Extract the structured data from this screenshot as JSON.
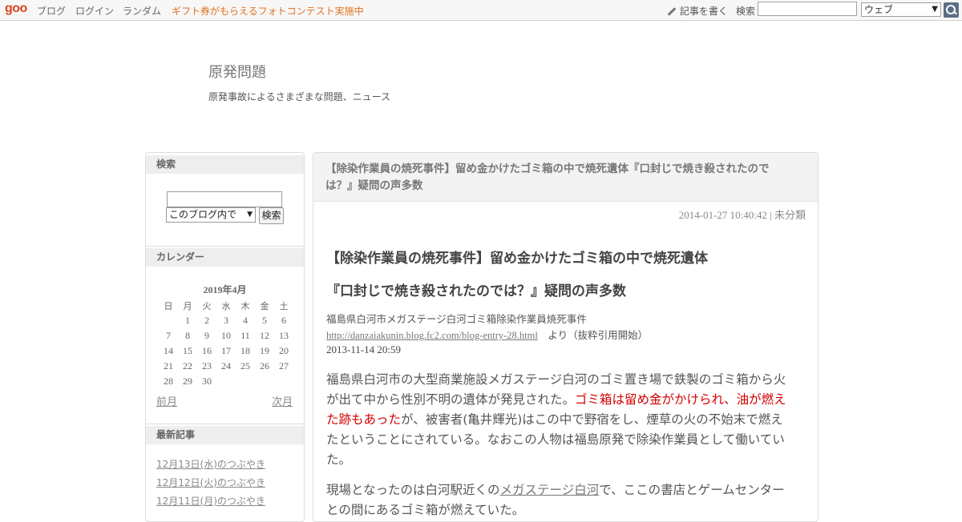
{
  "topbar": {
    "logo": "goo",
    "nav": [
      "ブログ",
      "ログイン",
      "ランダム"
    ],
    "promo": "ギフト券がもらえるフォトコンテスト実施中",
    "write_label": "記事を書く",
    "search_label": "検索",
    "search_value": "",
    "search_scope": "ウェブ"
  },
  "header": {
    "title": "原発問題",
    "description": "原発事故によるさまざまな問題、ニュース"
  },
  "sidebar": {
    "search": {
      "heading": "検索",
      "input_value": "",
      "scope": "このブログ内で",
      "button": "検索"
    },
    "calendar": {
      "heading": "カレンダー",
      "title": "2019年4月",
      "weekdays": [
        "日",
        "月",
        "火",
        "水",
        "木",
        "金",
        "土"
      ],
      "weeks": [
        [
          "",
          "1",
          "2",
          "3",
          "4",
          "5",
          "6"
        ],
        [
          "7",
          "8",
          "9",
          "10",
          "11",
          "12",
          "13"
        ],
        [
          "14",
          "15",
          "16",
          "17",
          "18",
          "19",
          "20"
        ],
        [
          "21",
          "22",
          "23",
          "24",
          "25",
          "26",
          "27"
        ],
        [
          "28",
          "29",
          "30",
          "",
          "",
          "",
          ""
        ]
      ],
      "prev": "前月",
      "next": "次月"
    },
    "recent": {
      "heading": "最新記事",
      "items": [
        "12月13日(水)のつぶやき",
        "12月12日(火)のつぶやき",
        "12月11日(月)のつぶやき"
      ]
    }
  },
  "article": {
    "header_title": "【除染作業員の焼死事件】留め金かけたゴミ箱の中で焼死遺体『口封じで焼き殺されたのではないか？』疑問の声多数",
    "header_line1": "【除染作業員の焼死事件】留め金かけたゴミ箱の中で焼死遺体『口封じで焼き殺されたので",
    "header_line2": "は？』疑問の声多数",
    "date": "2014-01-27 10:40:42",
    "category": "未分類",
    "meta_sep": "|",
    "heading1": "【除染作業員の焼死事件】留め金かけたゴミ箱の中で焼死遺体",
    "heading2": "『口封じで焼き殺されたのでは？』疑問の声多数",
    "source_title": "福島県白河市メガステージ白河ゴミ箱除染作業員焼死事件",
    "source_url": "http://danzaiakunin.blog.fc2.com/blog-entry-28.html",
    "source_suffix": "　より（抜粋引用開始）",
    "source_date": "2013-11-14 20:59",
    "p1_l1": "福島県白河市の大型商業施設メガステージ白河のゴミ置き場で鉄製のゴミ箱から火",
    "p1_l2_a": "が出て中から性別不明の遺体が発見された。",
    "p1_l2_red": "ゴミ箱は留め金がかけられ、油が燃え",
    "p1_l3_red": "た跡もあった",
    "p1_l3_b": "が、被害者(亀井輝光)はこの中で野宿をし、煙草の火の不始末で燃え",
    "p1_l4": "たということにされている。なおこの人物は福島原発で除染作業員として働いてい",
    "p1_l5": "た。",
    "p2_l1_a": "現場となったのは白河駅近くの",
    "p2_l1_link": "メガステージ白河",
    "p2_l1_b": "で、ここの書店とゲームセンター",
    "p2_l2": "との間にあるゴミ箱が燃えていた。"
  }
}
